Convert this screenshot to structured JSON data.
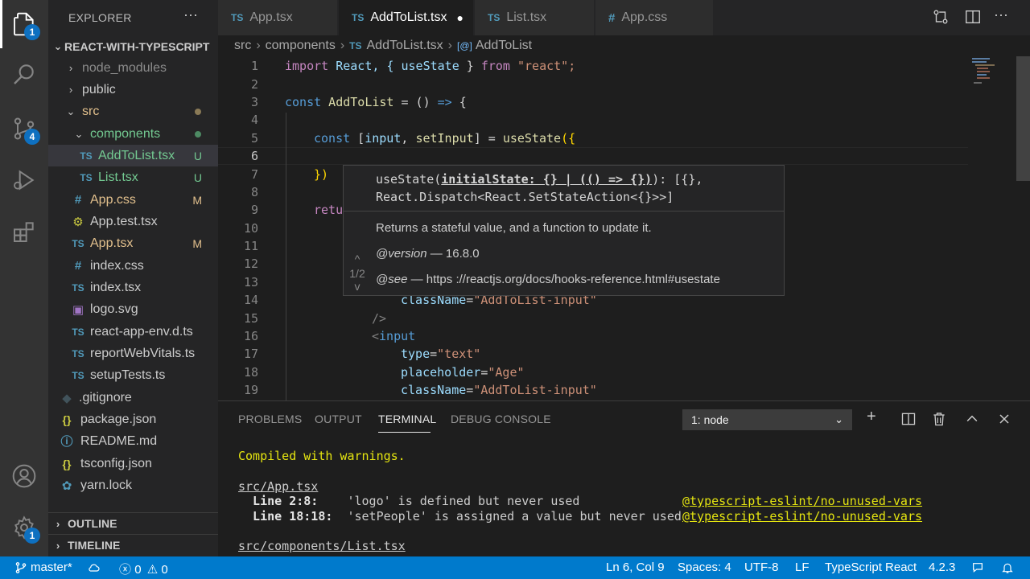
{
  "activity": {
    "explorer_badge": "1",
    "scm_badge": "4",
    "settings_badge": "1"
  },
  "sidebar": {
    "title": "EXPLORER",
    "more": "···",
    "project": "REACT-WITH-TYPESCRIPT",
    "items": [
      {
        "label": "node_modules",
        "icon": "›",
        "color": "#8b8b8b"
      },
      {
        "label": "public",
        "icon": "›",
        "color": "#cccccc"
      },
      {
        "label": "src",
        "color": "#e2c08d"
      },
      {
        "label": "components",
        "color": "#73c991"
      },
      {
        "label": "AddToList.tsx",
        "icon": "TS",
        "mark": "U",
        "color": "#73c991"
      },
      {
        "label": "List.tsx",
        "icon": "TS",
        "mark": "U",
        "color": "#73c991"
      },
      {
        "label": "App.css",
        "icon": "#",
        "mark": "M",
        "color": "#e2c08d"
      },
      {
        "label": "App.test.tsx",
        "color": "#cccccc"
      },
      {
        "label": "App.tsx",
        "icon": "TS",
        "mark": "M",
        "color": "#e2c08d"
      },
      {
        "label": "index.css",
        "icon": "#",
        "color": "#cccccc"
      },
      {
        "label": "index.tsx",
        "icon": "TS",
        "color": "#cccccc"
      },
      {
        "label": "logo.svg",
        "color": "#cccccc"
      },
      {
        "label": "react-app-env.d.ts",
        "icon": "TS",
        "color": "#cccccc"
      },
      {
        "label": "reportWebVitals.ts",
        "icon": "TS",
        "color": "#cccccc"
      },
      {
        "label": "setupTests.ts",
        "icon": "TS",
        "color": "#cccccc"
      },
      {
        "label": ".gitignore",
        "color": "#cccccc"
      },
      {
        "label": "package.json",
        "icon": "{}",
        "color": "#cccccc"
      },
      {
        "label": "README.md",
        "color": "#cccccc"
      },
      {
        "label": "tsconfig.json",
        "icon": "{}",
        "color": "#cccccc"
      },
      {
        "label": "yarn.lock",
        "color": "#cccccc"
      }
    ],
    "outline": "OUTLINE",
    "timeline": "TIMELINE"
  },
  "tabs": [
    {
      "icon": "TS",
      "label": "App.tsx"
    },
    {
      "icon": "TS",
      "label": "AddToList.tsx",
      "dirty": "●"
    },
    {
      "icon": "TS",
      "label": "List.tsx"
    },
    {
      "icon": "#",
      "label": "App.css"
    }
  ],
  "tab_actions": {
    "more": "···"
  },
  "breadcrumb": {
    "seg1": "src",
    "seg2": "components",
    "seg3_icon": "TS",
    "seg3": "AddToList.tsx",
    "seg4_icon": "[@]",
    "seg4": "AddToList",
    "separator": "›"
  },
  "editor": {
    "line_numbers": [
      "1",
      "2",
      "3",
      "4",
      "5",
      "6",
      "7",
      "8",
      "9",
      "10",
      "11",
      "12",
      "13",
      "14",
      "15",
      "16",
      "17",
      "18",
      "19"
    ],
    "l1": {
      "kw": "import",
      "a": " React, { ",
      "b": "useState",
      "c": " } ",
      "d": "from",
      "e": " \"react\";"
    },
    "l3": {
      "kw": "const",
      "a": " AddToList",
      "b": " = () ",
      "c": "=>",
      "d": " {"
    },
    "l5": {
      "kw": "const",
      "a": " [",
      "b": "input",
      "c": ", ",
      "d": "setInput",
      "e": "] = ",
      "f": "useState",
      "g": "({"
    },
    "l7": "})",
    "l9": "retu",
    "l14": {
      "attr": "className",
      "eq": "=",
      "val": "\"AddToList-input\""
    },
    "l15": "/>",
    "l16": {
      "lt": "<",
      "tag": "input"
    },
    "l17": {
      "attr": "type",
      "eq": "=",
      "val": "\"text\""
    },
    "l18": {
      "attr": "placeholder",
      "eq": "=",
      "val": "\"Age\""
    },
    "l19": {
      "attr": "className",
      "eq": "=",
      "val": "\"AddToList-input\""
    }
  },
  "hover": {
    "sig_fn": "useState(",
    "sig_param": "initialState: {} | (() => {})",
    "sig_rest": "): [{},",
    "sig_line2": "React.Dispatch<React.SetStateAction<{}>>]",
    "description": "Returns a stateful value, and a function to update it.",
    "version_tag": "@version",
    "version_val": " — 16.8.0",
    "see_tag": "@see",
    "see_val": " — https ://reactjs.org/docs/hooks-reference.html#usestate",
    "nav_up": "^",
    "nav_count": "1/2",
    "nav_down": "v"
  },
  "panel": {
    "tabs": [
      "PROBLEMS",
      "OUTPUT",
      "TERMINAL",
      "DEBUG CONSOLE"
    ],
    "terminal_select": "1: node",
    "terminal": {
      "line1": "Compiled with warnings.",
      "line2": "src/App.tsx",
      "w1_loc": "  Line 2:8:",
      "w1_msg": "    'logo' is defined but never used",
      "w1_rule": "@typescript-eslint/no-unused-vars",
      "w2_loc": "  Line 18:18:",
      "w2_msg": "  'setPeople' is assigned a value but never used",
      "w2_rule": "@typescript-eslint/no-unused-vars",
      "line3": "src/components/List.tsx"
    }
  },
  "statusbar": {
    "branch": "master*",
    "errors": "0",
    "warnings": "0",
    "position": "Ln 6, Col 9",
    "spaces": "Spaces: 4",
    "encoding": "UTF-8",
    "eol": "LF",
    "language": "TypeScript React",
    "version": "4.2.3"
  }
}
